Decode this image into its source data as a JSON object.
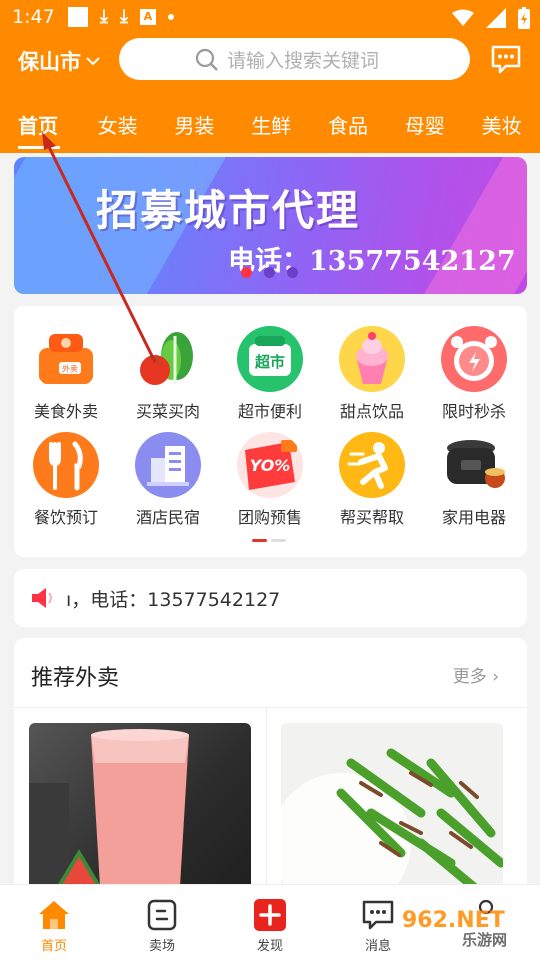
{
  "status_bar": {
    "time": "1:47"
  },
  "header": {
    "city": "保山市",
    "search_placeholder": "请输入搜索关键词",
    "tabs": [
      "首页",
      "女装",
      "男装",
      "生鲜",
      "食品",
      "母婴",
      "美妆"
    ]
  },
  "banner": {
    "title": "招募城市代理",
    "phone": "电话：13577542127",
    "dots_total": 3,
    "dots_active": 1
  },
  "categories": [
    {
      "label": "美食外卖",
      "icon": "takeout-box-icon"
    },
    {
      "label": "买菜买肉",
      "icon": "vegetables-icon"
    },
    {
      "label": "超市便利",
      "icon": "supermarket-icon",
      "badge": "超市"
    },
    {
      "label": "甜点饮品",
      "icon": "dessert-icon"
    },
    {
      "label": "限时秒杀",
      "icon": "alarm-clock-icon"
    },
    {
      "label": "餐饮预订",
      "icon": "fork-knife-icon"
    },
    {
      "label": "酒店民宿",
      "icon": "hotel-icon"
    },
    {
      "label": "团购预售",
      "icon": "group-buy-icon",
      "badge": "YO%"
    },
    {
      "label": "帮买帮取",
      "icon": "runner-icon"
    },
    {
      "label": "家用电器",
      "icon": "rice-cooker-icon"
    }
  ],
  "notice": {
    "text": "ı，电话：13577542127"
  },
  "recommend": {
    "title": "推荐外卖",
    "more": "更多",
    "items": [
      {
        "image": "watermelon-juice"
      },
      {
        "image": "stir-fried-pepper-pork"
      }
    ]
  },
  "bottom_nav": [
    {
      "label": "首页",
      "icon": "home-icon",
      "active": true
    },
    {
      "label": "卖场",
      "icon": "store-icon"
    },
    {
      "label": "发现",
      "icon": "plus-icon"
    },
    {
      "label": "消息",
      "icon": "message-icon"
    }
  ],
  "watermark": {
    "text": "962.NET",
    "sub": "乐游网"
  },
  "colors": {
    "brand": "#ff8a00",
    "active_dot": "#ff3344",
    "nav_active": "#ff8a00"
  }
}
